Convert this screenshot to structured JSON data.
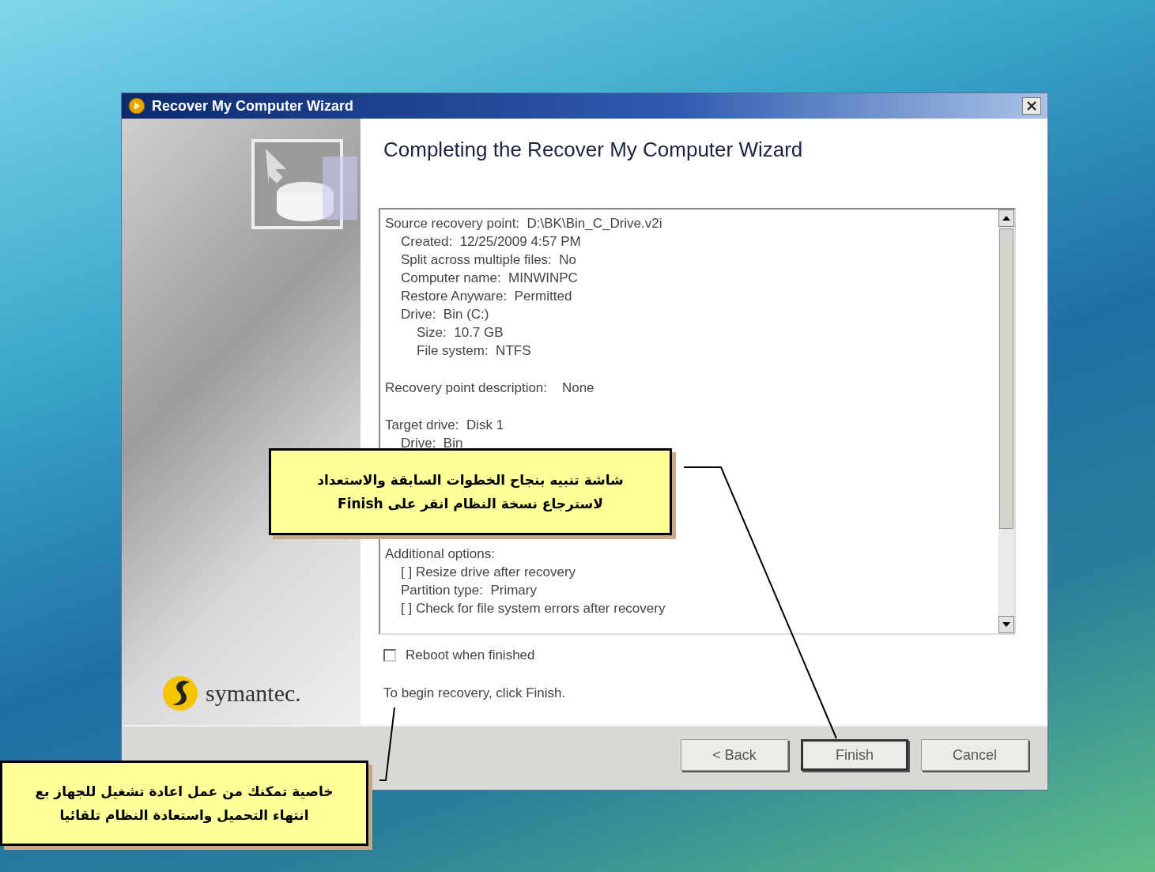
{
  "window": {
    "title": "Recover My Computer Wizard"
  },
  "left_panel": {
    "brand": "symantec."
  },
  "heading": "Completing the Recover My Computer Wizard",
  "summary": [
    {
      "text": "Source recovery point:  D:\\BK\\Bin_C_Drive.v2i",
      "children": [
        {
          "text": "Created:  12/25/2009 4:57 PM"
        },
        {
          "text": "Split across multiple files:  No"
        },
        {
          "text": "Computer name:  MINWINPC"
        },
        {
          "text": "Restore Anyware:  Permitted"
        },
        {
          "text": "Drive:  Bin (C:)",
          "children": [
            {
              "text": "Size:  10.7 GB"
            },
            {
              "text": "File system:  NTFS"
            }
          ]
        }
      ]
    },
    {
      "text": "Recovery point description:    None"
    },
    {
      "text": "Target drive:  Disk 1",
      "children": [
        {
          "text": "Drive:  Bin"
        }
      ]
    },
    {
      "text": "Additional options:",
      "children": [
        {
          "text": "[ ] Resize drive after recovery"
        },
        {
          "text": "Partition type:  Primary"
        },
        {
          "text": "[ ] Check for file system errors after recovery"
        }
      ]
    }
  ],
  "reboot_checkbox": {
    "label": "Reboot when finished",
    "checked": false
  },
  "hint": "To begin recovery, click Finish.",
  "buttons": [
    {
      "label": "< Back",
      "default": false
    },
    {
      "label": "Finish",
      "default": true
    },
    {
      "label": "Cancel",
      "default": false
    }
  ],
  "callouts": [
    {
      "lines": [
        "شاشة تنبيه بنجاح الخطوات السابقة والاستعداد",
        "لاسترجاع نسخة النظام انقر على Finish"
      ]
    },
    {
      "lines": [
        "خاصية تمكنك من عمل اعادة تشغيل للجهاز بع",
        "انتهاء التحميل واستعادة النظام تلقائيا"
      ]
    }
  ]
}
